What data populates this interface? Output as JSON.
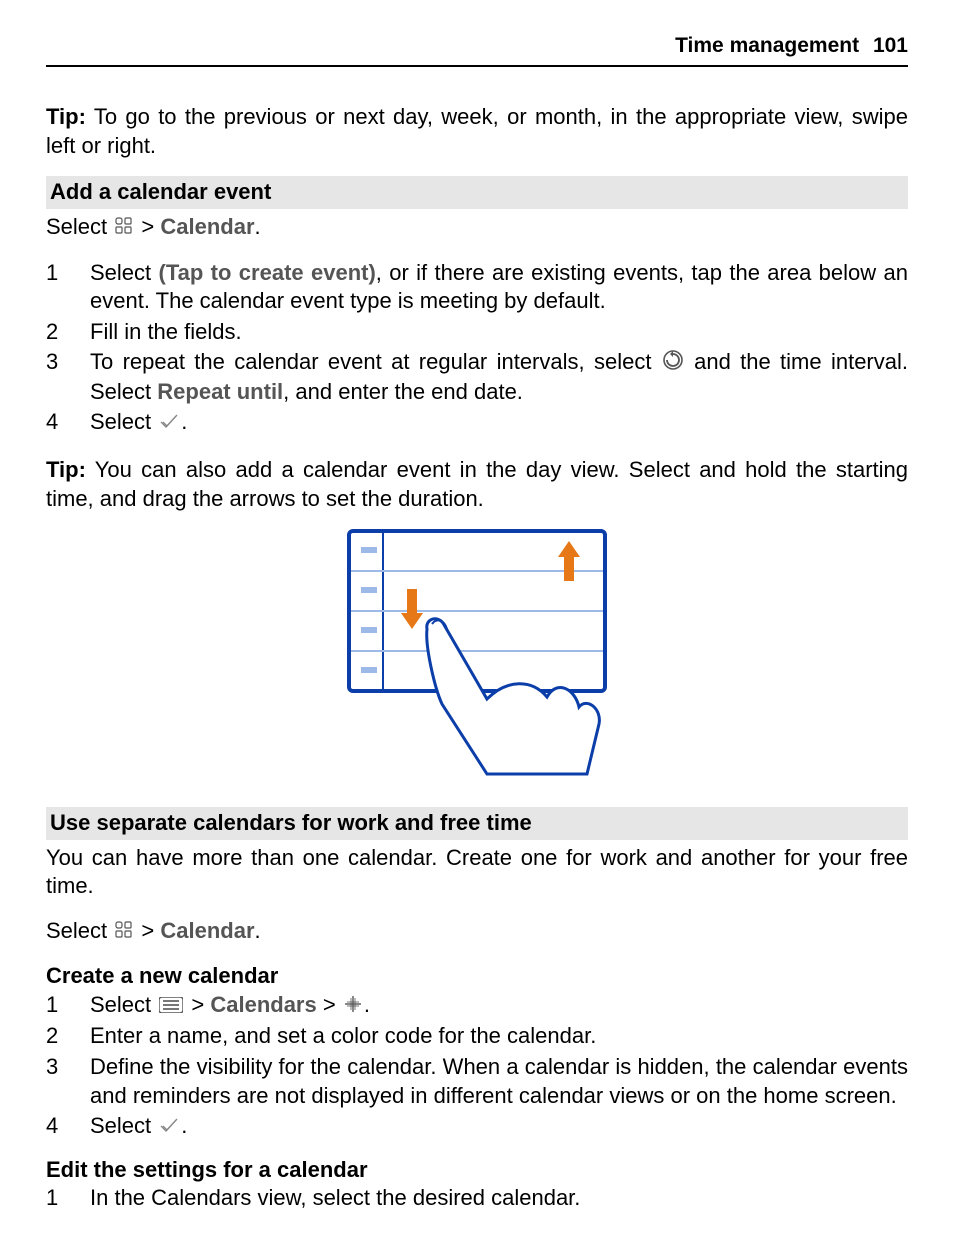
{
  "header": {
    "title": "Time management",
    "page": "101"
  },
  "tip1": {
    "label": "Tip:",
    "text": " To go to the previous or next day, week, or month, in the appropriate view, swipe left or right."
  },
  "section_a": {
    "title": "Add a calendar event",
    "select_prefix": "Select ",
    "select_midfix": " > ",
    "calendar_label": "Calendar",
    "select_suffix": ".",
    "step1_a": "Select ",
    "step1_bold": "(Tap to create event)",
    "step1_b": ", or if there are existing events, tap the area below an event. The calendar event type is meeting by default.",
    "step2": "Fill in the fields.",
    "step3_a": "To repeat the calendar event at regular intervals, select ",
    "step3_b": " and the time interval. Select ",
    "step3_bold2": "Repeat until",
    "step3_c": ", and enter the end date.",
    "step4_a": "Select ",
    "step4_b": "."
  },
  "tip2": {
    "label": "Tip:",
    "text": " You can also add a calendar event in the day view. Select and hold the starting time, and drag the arrows to set the duration."
  },
  "section_b": {
    "title": "Use separate calendars for work and free time",
    "intro": "You can have more than one calendar. Create one for work and another for your free time.",
    "select_prefix": "Select ",
    "select_midfix": " > ",
    "calendar_label": "Calendar",
    "select_suffix": "."
  },
  "sub_create": {
    "title": "Create a new calendar",
    "step1_a": "Select ",
    "step1_mid1": " > ",
    "step1_calendars": "Calendars",
    "step1_mid2": " > ",
    "step1_end": ".",
    "step2": "Enter a name, and set a color code for the calendar.",
    "step3": "Define the visibility for the calendar. When a calendar is hidden, the calendar events and reminders are not displayed in different calendar views or on the home screen.",
    "step4_a": "Select ",
    "step4_b": "."
  },
  "sub_edit": {
    "title": "Edit the settings for a calendar",
    "step1": "In the Calendars view, select the desired calendar."
  }
}
